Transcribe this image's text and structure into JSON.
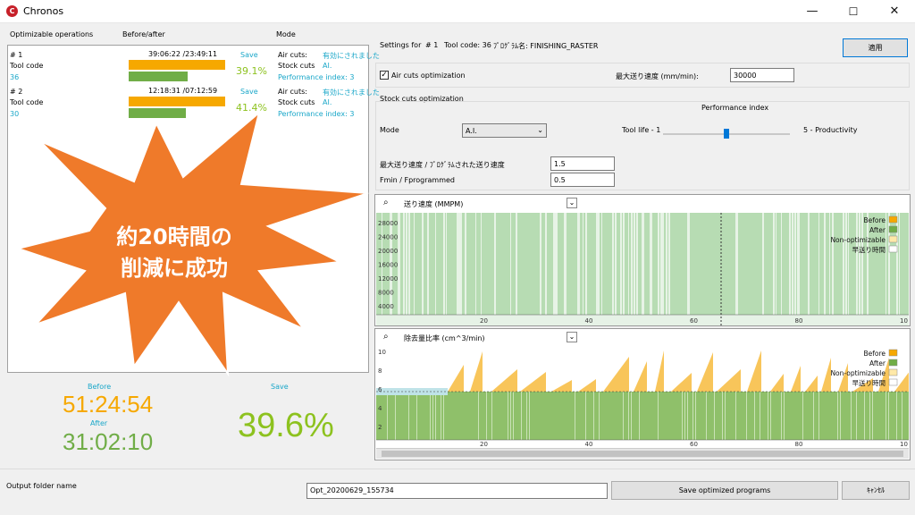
{
  "window": {
    "title": "Chronos",
    "minimize_glyph": "—",
    "maximize_glyph": "☐",
    "close_glyph": "✕"
  },
  "left": {
    "headers": {
      "ops": "Optimizable operations",
      "before_after": "Before/after",
      "mode": "Mode"
    },
    "rows": [
      {
        "number": "# 1",
        "tool_code_label": "Tool code",
        "tool_code": "36",
        "times": "39:06:22 /23:49:11",
        "save_label": "Save",
        "pct": "39.1%",
        "air_label": "Air cuts:",
        "air_value": "有効にされました",
        "stock_label": "Stock cuts",
        "stock_value": "AI.",
        "perf": "Performance index: 3",
        "before_frac": 1.0,
        "after_frac": 0.61
      },
      {
        "number": "# 2",
        "tool_code_label": "Tool code",
        "tool_code": "30",
        "times": "12:18:31 /07:12:59",
        "save_label": "Save",
        "pct": "41.4%",
        "air_label": "Air cuts:",
        "air_value": "有効にされました",
        "stock_label": "Stock cuts",
        "stock_value": "AI.",
        "perf": "Performance index: 3",
        "before_frac": 1.0,
        "after_frac": 0.59
      }
    ],
    "summary": {
      "before_label": "Before",
      "before_time": "51:24:54",
      "after_label": "After",
      "after_time": "31:02:10",
      "save_label": "Save",
      "save_pct": "39.6%"
    }
  },
  "callout": {
    "line1": "約20時間の",
    "line2": "削減に成功",
    "color": "#ef7a2a"
  },
  "settings": {
    "settings_for": "Settings for",
    "op_number": "# 1",
    "tool_code": "Tool code: 36",
    "program": "ﾌﾟﾛｸﾞﾗﾑ名: FINISHING_RASTER",
    "apply_label": "適用",
    "air_cuts_label": "Air cuts optimization",
    "air_cuts_checked": true,
    "max_feed_label": "最大送り速度 (mm/min):",
    "max_feed_value": "30000",
    "stock_cuts_label": "Stock cuts optimization",
    "mode_label": "Mode",
    "mode_value": "A.I.",
    "perf_index_label": "Performance index",
    "tool_life_label": "Tool life - 1",
    "productivity_label": "5 - Productivity",
    "slider_value": 3,
    "ratio_label": "最大送り速度 / ﾌﾟﾛｸﾞﾗﾑされた送り速度",
    "ratio_value": "1.5",
    "fmin_label": "Fmin / Fprogrammed",
    "fmin_value": "0.5"
  },
  "chart1": {
    "select_label": "送り速度 (MMPM)",
    "legend": [
      "Before",
      "After",
      "Non-optimizable",
      "早送り時間"
    ],
    "y_ticks": [
      "28000",
      "24000",
      "20000",
      "16000",
      "12000",
      "8000",
      "4000"
    ],
    "x_ticks": [
      "20",
      "40",
      "60",
      "80",
      "10"
    ]
  },
  "chart2": {
    "select_label": "除去量比率 (cm^3/min)",
    "legend": [
      "Before",
      "After",
      "Non-optimizable",
      "早送り時間"
    ],
    "y_ticks": [
      "10",
      "8",
      "6",
      "4",
      "2"
    ],
    "x_ticks": [
      "20",
      "40",
      "60",
      "80",
      "10"
    ]
  },
  "footer": {
    "output_label": "Output folder name",
    "output_value": "Opt_20200629_155734",
    "save_label": "Save optimized programs",
    "cancel_label": "ｷｬﾝｾﾙ"
  },
  "colors": {
    "before": "#f6a800",
    "after": "#70ad47",
    "non_opt": "#ffe9a8",
    "teal": "#1aa7c9"
  }
}
